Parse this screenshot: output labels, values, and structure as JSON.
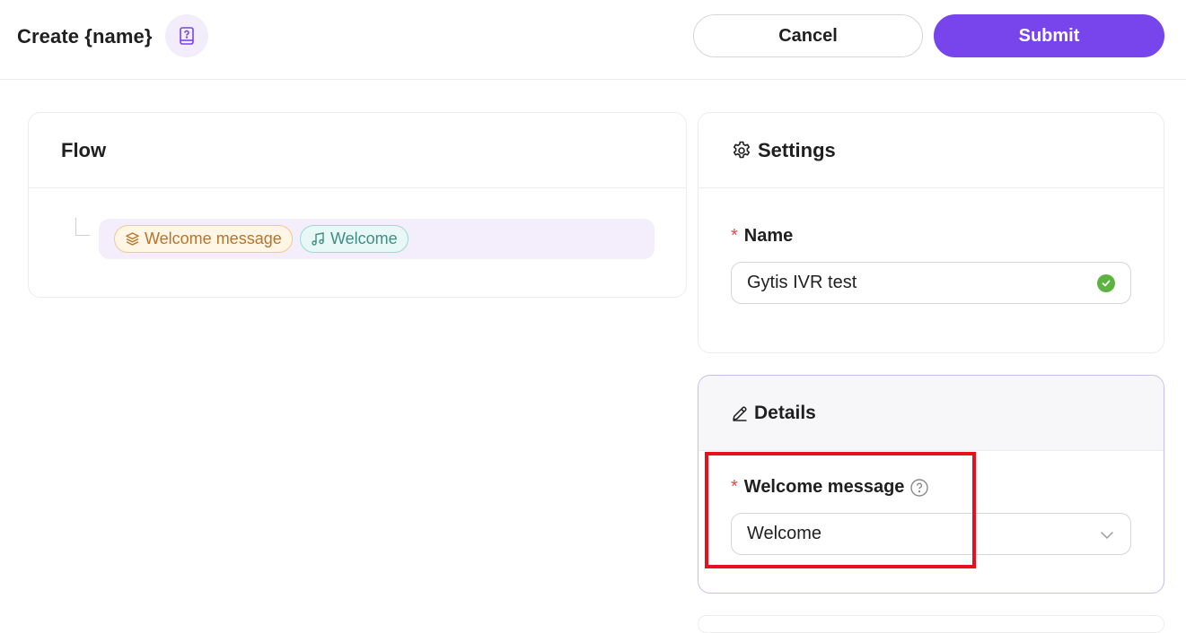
{
  "header": {
    "title": "Create {name}",
    "cancel_label": "Cancel",
    "submit_label": "Submit",
    "badge_icon": "book-question-icon"
  },
  "flow": {
    "title": "Flow",
    "tags": [
      {
        "label": "Welcome message",
        "icon": "layers-icon"
      },
      {
        "label": "Welcome",
        "icon": "music-note-icon"
      }
    ]
  },
  "settings": {
    "title": "Settings",
    "icon": "gear-icon",
    "name_label": "Name",
    "name_value": "Gytis IVR test"
  },
  "details": {
    "title": "Details",
    "icon": "pencil-icon",
    "welcome_label": "Welcome message",
    "welcome_value": "Welcome"
  },
  "colors": {
    "accent": "#7844ec",
    "required": "#e04b4b",
    "highlight": "#e8101c"
  }
}
